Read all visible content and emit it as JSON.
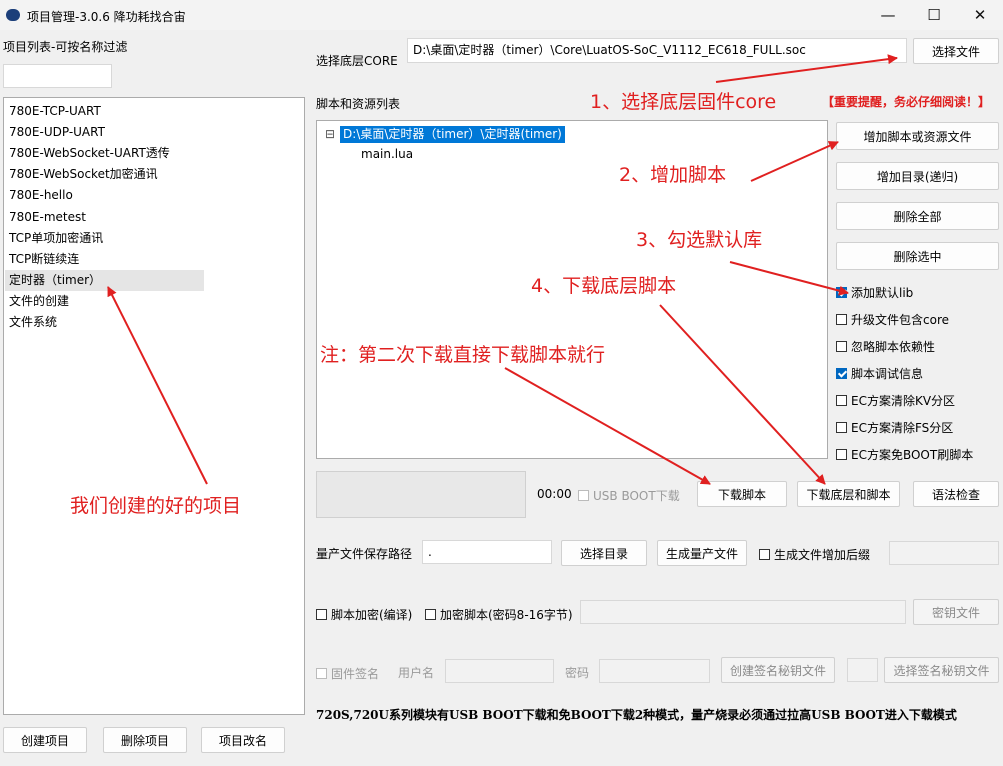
{
  "window": {
    "title": "项目管理-3.0.6 降功耗找合宙",
    "minimize": "—",
    "maximize": "☐",
    "close": "✕"
  },
  "left": {
    "header": "项目列表-可按名称过滤",
    "filter_value": "",
    "projects": [
      "780E-TCP-UART",
      "780E-UDP-UART",
      "780E-WebSocket-UART透传",
      "780E-WebSocket加密通讯",
      "780E-hello",
      "780E-metest",
      "TCP单项加密通讯",
      "TCP断链续连",
      "定时器（timer）",
      "文件的创建",
      "文件系统"
    ],
    "selected_index": 8,
    "buttons": {
      "create": "创建项目",
      "delete": "删除项目",
      "rename": "项目改名"
    }
  },
  "core": {
    "label": "选择底层CORE",
    "path": "D:\\桌面\\定时器（timer）\\Core\\LuatOS-SoC_V1112_EC618_FULL.soc",
    "select_button": "选择文件"
  },
  "scripts": {
    "label": "脚本和资源列表",
    "tree_root": "D:\\桌面\\定时器（timer）\\定时器(timer)",
    "tree_expander": "⊟",
    "files": [
      "main.lua"
    ],
    "buttons": {
      "add_files": "增加脚本或资源文件",
      "add_dir": "增加目录(递归)",
      "delete_all": "删除全部",
      "delete_selected": "删除选中"
    },
    "options": [
      {
        "label": "添加默认lib",
        "checked": true
      },
      {
        "label": "升级文件包含core",
        "checked": false
      },
      {
        "label": "忽略脚本依赖性",
        "checked": false
      },
      {
        "label": "脚本调试信息",
        "checked": true
      },
      {
        "label": "EC方案清除KV分区",
        "checked": false
      },
      {
        "label": "EC方案清除FS分区",
        "checked": false
      },
      {
        "label": "EC方案免BOOT刷脚本",
        "checked": false
      }
    ]
  },
  "download": {
    "timer": "00:00",
    "usb_boot_label": "USB BOOT下载",
    "download_script": "下载脚本",
    "download_core_script": "下载底层和脚本",
    "syntax_check": "语法检查"
  },
  "mass": {
    "path_label": "量产文件保存路径",
    "path_value": ".",
    "select_dir": "选择目录",
    "generate": "生成量产文件",
    "suffix_label": "生成文件增加后缀"
  },
  "encrypt": {
    "compile_label": "脚本加密(编译)",
    "password_label": "加密脚本(密码8-16字节)",
    "key_file": "密钥文件"
  },
  "sign": {
    "firmware_sign": "固件签名",
    "username_label": "用户名",
    "password_label": "密码",
    "create_key": "创建签名秘钥文件",
    "select_key": "选择签名秘钥文件"
  },
  "notice_bar": "720S,720U系列模块有USB BOOT下载和免BOOT下载2种模式，量产烧录必须通过拉高USB BOOT进入下载模式",
  "annotations": {
    "step1": "1、选择底层固件core",
    "important": "【重要提醒，务必仔细阅读！】",
    "step2": "2、增加脚本",
    "step3": "3、勾选默认库",
    "step4": "4、下载底层脚本",
    "note": "注：第二次下载直接下载脚本就行",
    "projects_note": "我们创建的好的项目",
    "color": "#e02020"
  }
}
